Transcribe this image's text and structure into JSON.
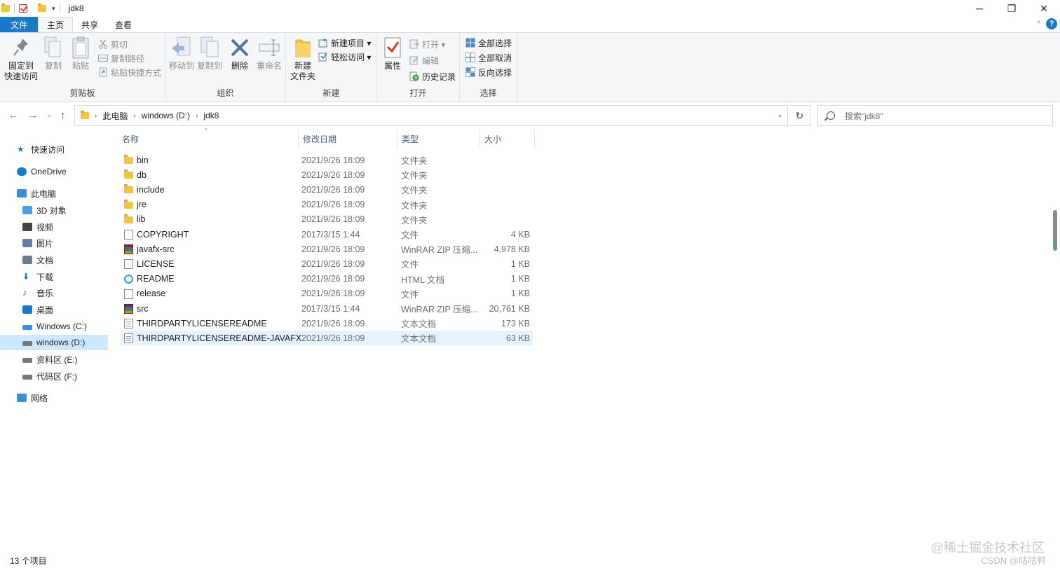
{
  "window": {
    "title": "jdk8",
    "min": "─",
    "max": "❐",
    "close": "✕"
  },
  "tabs": [
    {
      "label": "文件"
    },
    {
      "label": "主页"
    },
    {
      "label": "共享"
    },
    {
      "label": "查看"
    }
  ],
  "ribbon": {
    "clipboard": {
      "label": "剪贴板",
      "pin": "固定到\n快速访问",
      "copy": "复制",
      "paste": "粘贴",
      "cut": "剪切",
      "copy_path": "复制路径",
      "paste_shortcut": "粘贴快捷方式"
    },
    "organize": {
      "label": "组织",
      "move_to": "移动到",
      "copy_to": "复制到",
      "delete": "删除",
      "rename": "重命名"
    },
    "new": {
      "label": "新建",
      "new_folder": "新建\n文件夹",
      "new_item": "新建项目 ▾",
      "easy_access": "轻松访问 ▾"
    },
    "open": {
      "label": "打开",
      "properties": "属性",
      "open": "打开 ▾",
      "edit": "编辑",
      "history": "历史记录"
    },
    "select": {
      "label": "选择",
      "select_all": "全部选择",
      "select_none": "全部取消",
      "invert": "反向选择"
    }
  },
  "address": {
    "crumbs": [
      "此电脑",
      "windows (D:)",
      "jdk8"
    ],
    "search_placeholder": "搜索\"jdk8\""
  },
  "sidebar": [
    {
      "label": "快速访问",
      "icon": "star-icon",
      "color": "#1979ca"
    },
    {
      "label": "OneDrive",
      "icon": "cloud-icon",
      "color": "#1979ca"
    },
    {
      "label": "此电脑",
      "icon": "computer-icon",
      "color": "#3a8fd8"
    },
    {
      "label": "3D 对象",
      "icon": "cube-icon",
      "color": "#46a3e0"
    },
    {
      "label": "视频",
      "icon": "film-icon",
      "color": "#444444"
    },
    {
      "label": "图片",
      "icon": "picture-icon",
      "color": "#5f7fa8"
    },
    {
      "label": "文档",
      "icon": "document-icon",
      "color": "#6b7b8c"
    },
    {
      "label": "下载",
      "icon": "download-icon",
      "color": "#1979ca"
    },
    {
      "label": "音乐",
      "icon": "music-icon",
      "color": "#1979ca"
    },
    {
      "label": "桌面",
      "icon": "desktop-icon",
      "color": "#1979ca"
    },
    {
      "label": "Windows  (C:)",
      "icon": "drive-windows-icon",
      "color": "#3a8fd8"
    },
    {
      "label": "windows (D:)",
      "icon": "drive-icon",
      "color": "#777777"
    },
    {
      "label": "资料区 (E:)",
      "icon": "drive-icon",
      "color": "#777777"
    },
    {
      "label": "代码区 (F:)",
      "icon": "drive-icon",
      "color": "#777777"
    },
    {
      "label": "网络",
      "icon": "network-icon",
      "color": "#3a8fd8"
    }
  ],
  "columns": {
    "name": "名称",
    "date": "修改日期",
    "type": "类型",
    "size": "大小"
  },
  "files": [
    {
      "name": "bin",
      "date": "2021/9/26 18:09",
      "type": "文件夹",
      "size": "",
      "icon": "folder"
    },
    {
      "name": "db",
      "date": "2021/9/26 18:09",
      "type": "文件夹",
      "size": "",
      "icon": "folder"
    },
    {
      "name": "include",
      "date": "2021/9/26 18:09",
      "type": "文件夹",
      "size": "",
      "icon": "folder"
    },
    {
      "name": "jre",
      "date": "2021/9/26 18:09",
      "type": "文件夹",
      "size": "",
      "icon": "folder"
    },
    {
      "name": "lib",
      "date": "2021/9/26 18:09",
      "type": "文件夹",
      "size": "",
      "icon": "folder"
    },
    {
      "name": "COPYRIGHT",
      "date": "2017/3/15 1:44",
      "type": "文件",
      "size": "4 KB",
      "icon": "doc"
    },
    {
      "name": "javafx-src",
      "date": "2021/9/26 18:09",
      "type": "WinRAR ZIP 压缩...",
      "size": "4,978 KB",
      "icon": "zip"
    },
    {
      "name": "LICENSE",
      "date": "2021/9/26 18:09",
      "type": "文件",
      "size": "1 KB",
      "icon": "doc"
    },
    {
      "name": "README",
      "date": "2021/9/26 18:09",
      "type": "HTML 文档",
      "size": "1 KB",
      "icon": "html"
    },
    {
      "name": "release",
      "date": "2021/9/26 18:09",
      "type": "文件",
      "size": "1 KB",
      "icon": "doc"
    },
    {
      "name": "src",
      "date": "2017/3/15 1:44",
      "type": "WinRAR ZIP 压缩...",
      "size": "20,761 KB",
      "icon": "zip"
    },
    {
      "name": "THIRDPARTYLICENSEREADME",
      "date": "2021/9/26 18:09",
      "type": "文本文档",
      "size": "173 KB",
      "icon": "txt"
    },
    {
      "name": "THIRDPARTYLICENSEREADME-JAVAFX",
      "date": "2021/9/26 18:09",
      "type": "文本文档",
      "size": "63 KB",
      "icon": "txt",
      "selected": true
    }
  ],
  "status": {
    "count": "13 个项目"
  },
  "watermark": {
    "line1": "@稀土掘金技术社区",
    "line2": "CSDN @咕咕鸭"
  },
  "colors": {
    "accent": "#1979ca",
    "selection": "#cce8ff",
    "hover_row": "#e5f3ff",
    "folder": "#f3c43c"
  }
}
